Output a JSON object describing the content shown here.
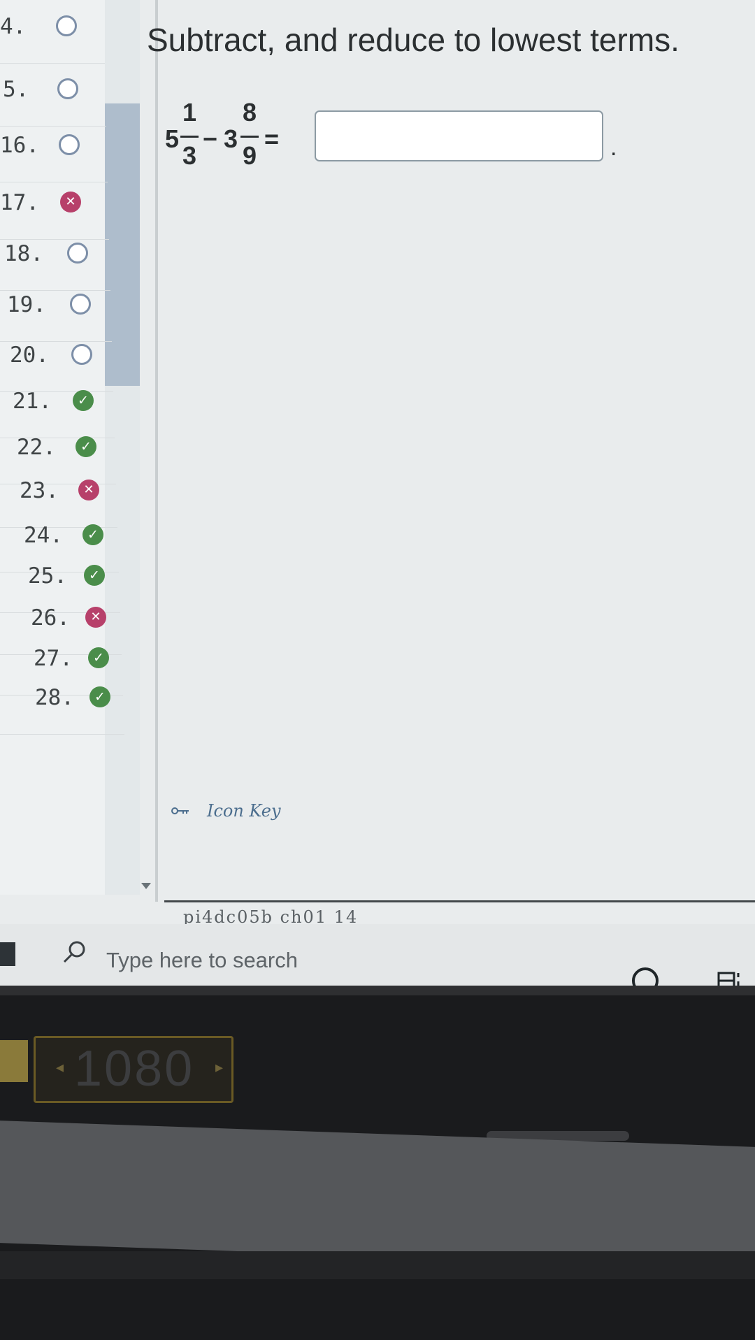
{
  "sidebar": {
    "questions": [
      {
        "num": "4.",
        "status": "empty"
      },
      {
        "num": "5.",
        "status": "empty"
      },
      {
        "num": "16.",
        "status": "empty"
      },
      {
        "num": "17.",
        "status": "wrong"
      },
      {
        "num": "18.",
        "status": "empty"
      },
      {
        "num": "19.",
        "status": "empty"
      },
      {
        "num": "20.",
        "status": "empty"
      },
      {
        "num": "21.",
        "status": "correct"
      },
      {
        "num": "22.",
        "status": "correct"
      },
      {
        "num": "23.",
        "status": "wrong"
      },
      {
        "num": "24.",
        "status": "correct"
      },
      {
        "num": "25.",
        "status": "correct"
      },
      {
        "num": "26.",
        "status": "wrong"
      },
      {
        "num": "27.",
        "status": "correct"
      },
      {
        "num": "28.",
        "status": "correct"
      }
    ]
  },
  "question": {
    "instruction": "Subtract, and reduce to lowest terms.",
    "term1": {
      "whole": "5",
      "numerator": "1",
      "denominator": "3"
    },
    "operator": "−",
    "term2": {
      "whole": "3",
      "numerator": "8",
      "denominator": "9"
    },
    "equals": "=",
    "answer_value": "",
    "trailing": "."
  },
  "icon_key": {
    "label": "Icon Key",
    "icon": "key-icon"
  },
  "footer_code": "pi4dc05b ch01 14",
  "taskbar": {
    "search_placeholder": "Type here to search",
    "icons": [
      "windows-start-icon",
      "search-icon",
      "cortana-icon",
      "task-view-icon"
    ]
  },
  "monitor": {
    "resolution": "1080",
    "prefix_arrow": "◂",
    "suffix_arrow": "▸"
  },
  "colors": {
    "correct": "#4a8d4a",
    "wrong": "#b7406a",
    "empty_ring": "#7d8fa8",
    "scroll_thumb": "#aebdcc"
  }
}
